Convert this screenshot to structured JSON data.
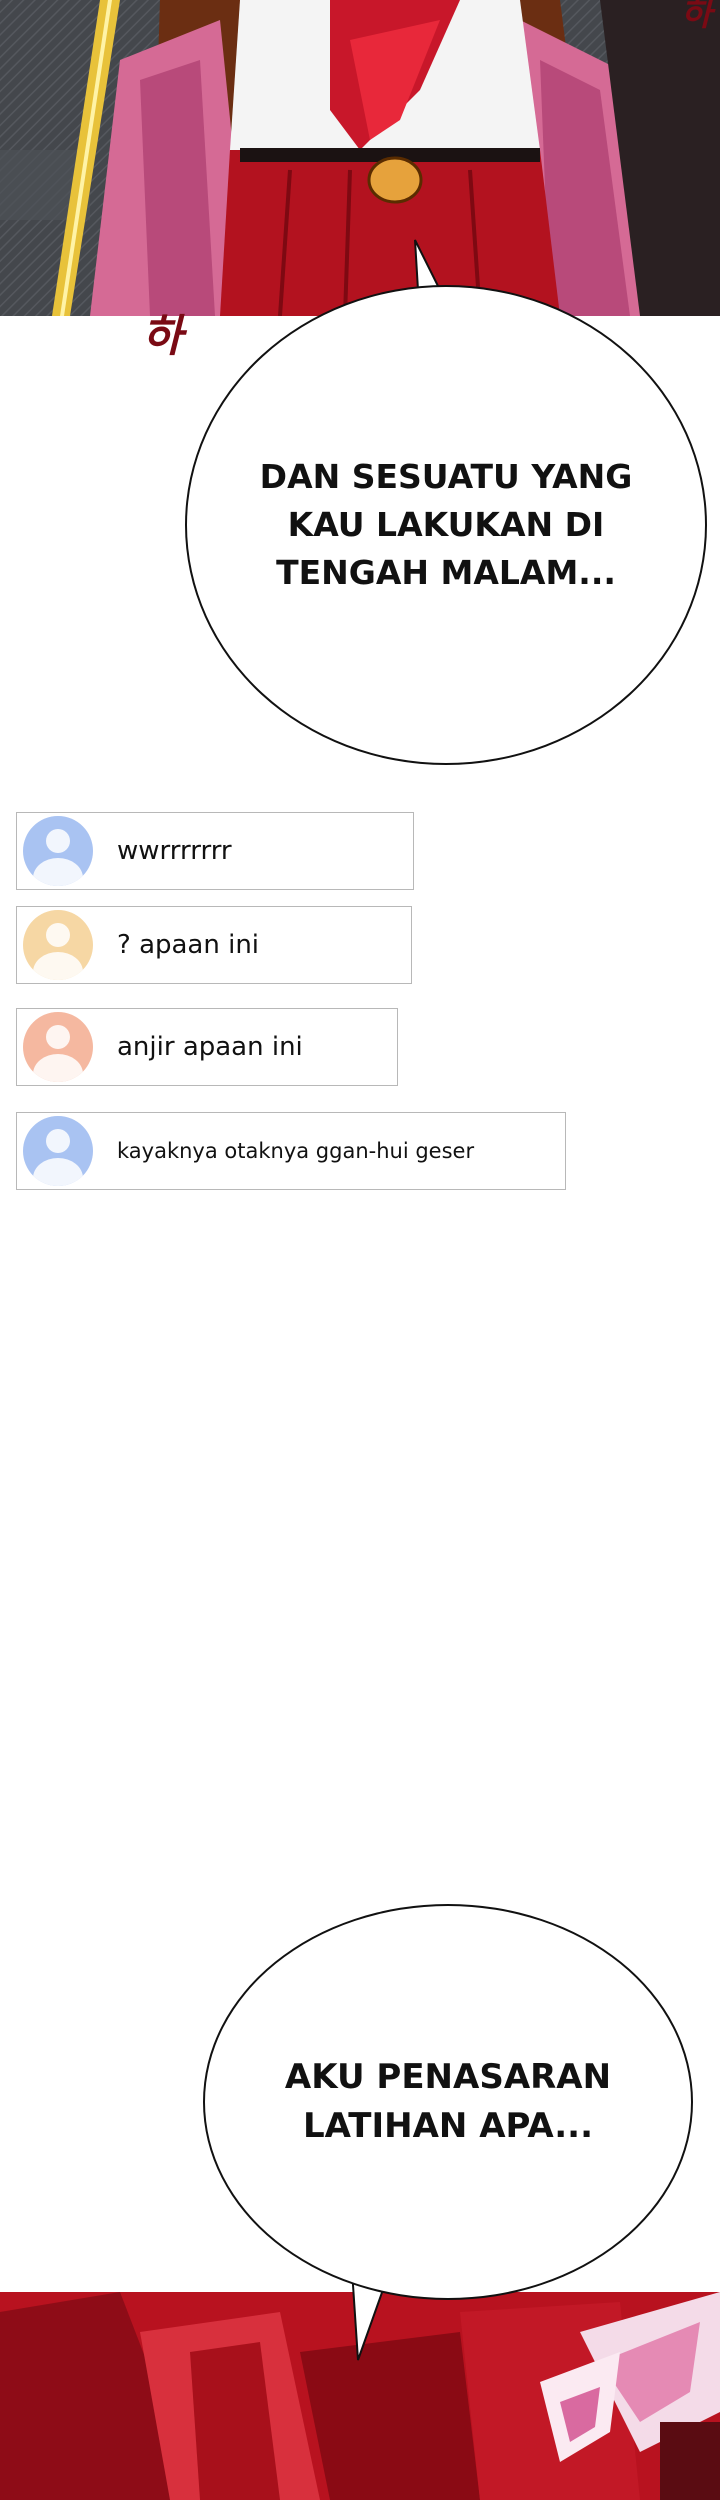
{
  "bubbles": [
    {
      "text": "DAN SESUATU YANG\nKAU LAKUKAN DI\nTENGAH MALAM..."
    },
    {
      "text": "AKU PENASARAN\nLATIHAN APA..."
    }
  ],
  "sfx": {
    "top_right": "하",
    "under_panel": "하"
  },
  "comments": [
    {
      "text": "wwrrrrrrr",
      "avatar_color": "#a9c3f2"
    },
    {
      "text": "? apaan ini",
      "avatar_color": "#f6d7a4"
    },
    {
      "text": "anjir apaan ini",
      "avatar_color": "#f5b8a0"
    },
    {
      "text": "kayaknya otaknya ggan-hui geser",
      "avatar_color": "#a9c3f2"
    }
  ],
  "colors": {
    "bubble_border": "#111111",
    "comment_border": "#b8b8b8",
    "panel_red": "#c8172a"
  }
}
